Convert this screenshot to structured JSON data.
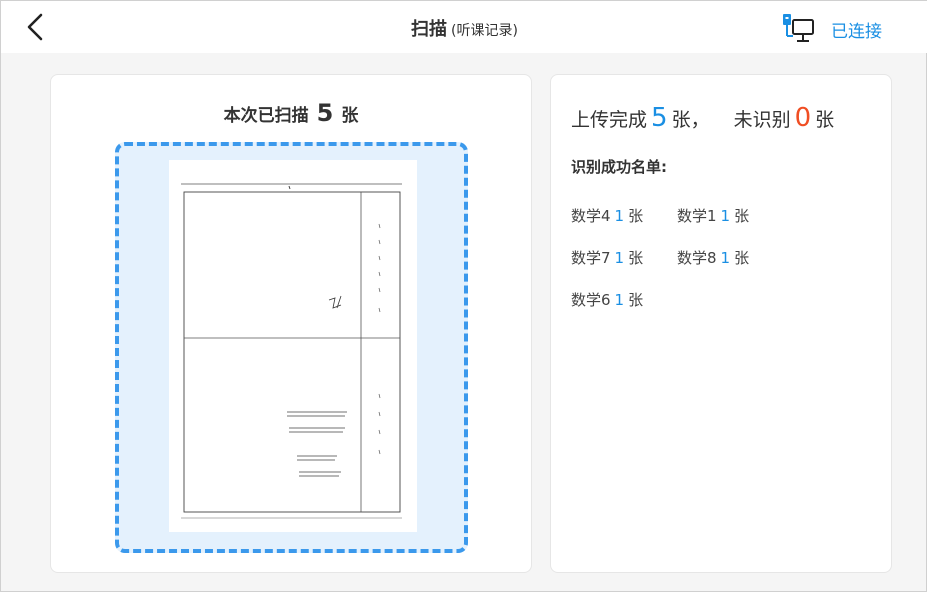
{
  "header": {
    "title": "扫描",
    "subtitle": "(听课记录)",
    "connection_status": "已连接",
    "back_icon": "chevron-left-icon",
    "connection_icon": "scanner-monitor-icon"
  },
  "scan": {
    "prefix": "本次已扫描",
    "count": "5",
    "unit": "张"
  },
  "upload": {
    "prefix": "上传完成",
    "done_count": "5",
    "done_unit": "张，",
    "unrecognized_prefix": "未识别",
    "unrecognized_count": "0",
    "unrecognized_unit": "张"
  },
  "success_list": {
    "title": "识别成功名单:",
    "items": [
      {
        "name": "数学4",
        "count": "1",
        "unit": "张"
      },
      {
        "name": "数学1",
        "count": "1",
        "unit": "张"
      },
      {
        "name": "数学7",
        "count": "1",
        "unit": "张"
      },
      {
        "name": "数学8",
        "count": "1",
        "unit": "张"
      },
      {
        "name": "数学6",
        "count": "1",
        "unit": "张"
      }
    ]
  },
  "colors": {
    "accent": "#1a8fe3",
    "danger": "#f04e23",
    "frame_border": "#3b99ec",
    "frame_fill": "#e4f1fd"
  }
}
